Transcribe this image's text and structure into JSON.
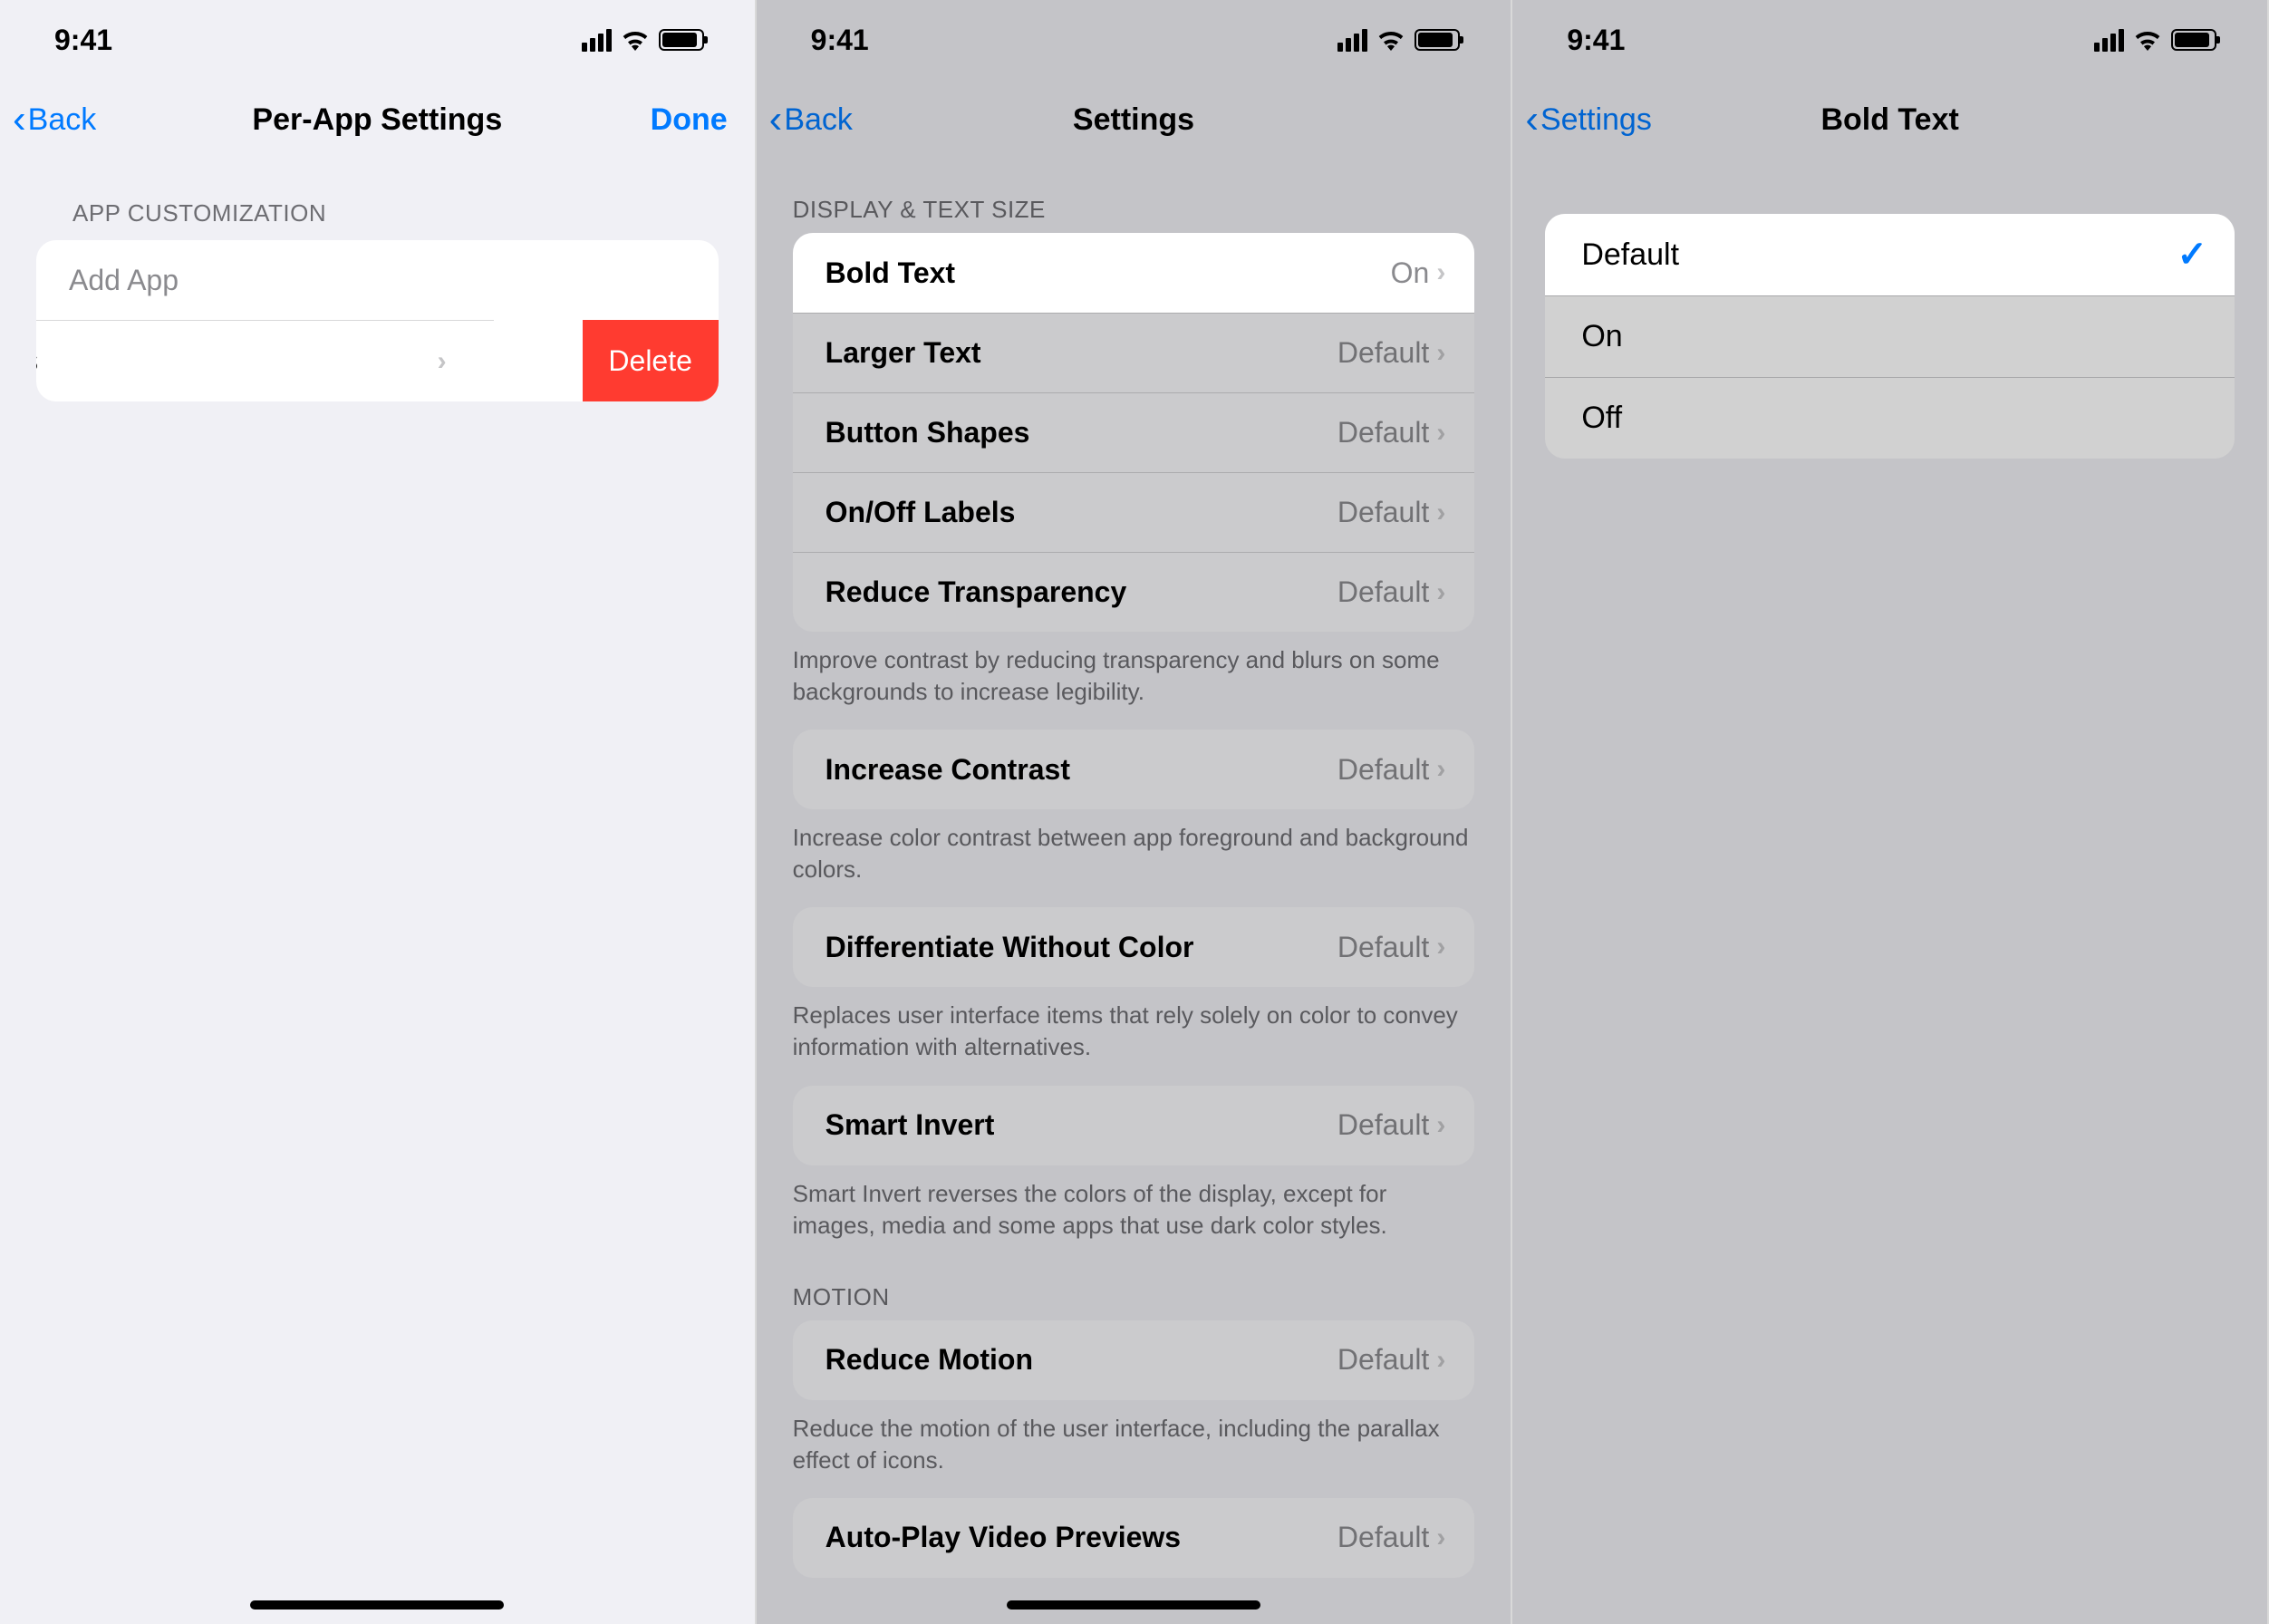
{
  "status": {
    "time": "9:41"
  },
  "frame1": {
    "nav": {
      "back": "Back",
      "title": "Per-App Settings",
      "done": "Done"
    },
    "section": "APP CUSTOMIZATION",
    "addApp": "Add App",
    "swipedItem": "ettings",
    "delete": "Delete"
  },
  "frame2": {
    "nav": {
      "back": "Back",
      "title": "Settings"
    },
    "sec1": "DISPLAY & TEXT SIZE",
    "rows1": [
      {
        "label": "Bold Text",
        "value": "On",
        "hl": true
      },
      {
        "label": "Larger Text",
        "value": "Default"
      },
      {
        "label": "Button Shapes",
        "value": "Default"
      },
      {
        "label": "On/Off Labels",
        "value": "Default"
      },
      {
        "label": "Reduce Transparency",
        "value": "Default"
      }
    ],
    "footer1": "Improve contrast by reducing transparency and blurs on some backgrounds to increase legibility.",
    "rows2": [
      {
        "label": "Increase Contrast",
        "value": "Default"
      }
    ],
    "footer2": "Increase color contrast between app foreground and background colors.",
    "rows3": [
      {
        "label": "Differentiate Without Color",
        "value": "Default"
      }
    ],
    "footer3": "Replaces user interface items that rely solely on color to convey information with alternatives.",
    "rows4": [
      {
        "label": "Smart Invert",
        "value": "Default"
      }
    ],
    "footer4": "Smart Invert reverses the colors of the display, except for images, media and some apps that use dark color styles.",
    "sec2": "MOTION",
    "rows5": [
      {
        "label": "Reduce Motion",
        "value": "Default"
      }
    ],
    "footer5": "Reduce the motion of the user interface, including the parallax effect of icons.",
    "rows6": [
      {
        "label": "Auto-Play Video Previews",
        "value": "Default"
      }
    ]
  },
  "frame3": {
    "nav": {
      "back": "Settings",
      "title": "Bold Text"
    },
    "options": [
      {
        "label": "Default",
        "checked": true,
        "hl": true
      },
      {
        "label": "On",
        "checked": false
      },
      {
        "label": "Off",
        "checked": false
      }
    ]
  }
}
